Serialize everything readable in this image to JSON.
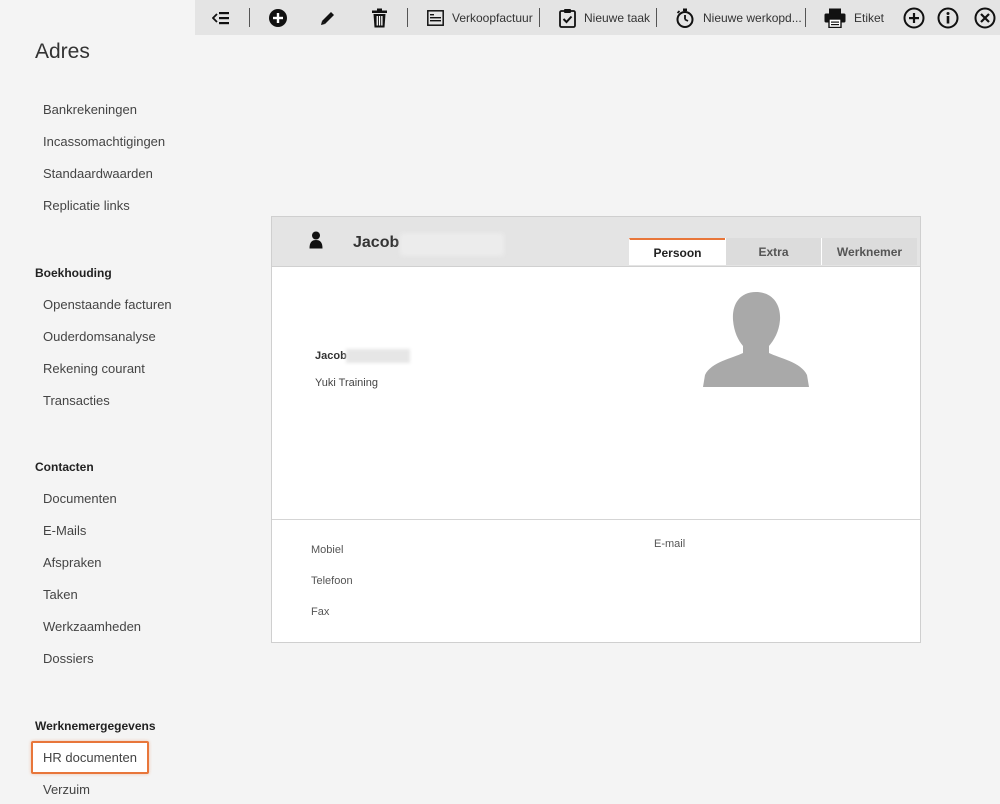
{
  "toolbar": {
    "verkoopfactuur": "Verkoopfactuur",
    "nieuwe_taak": "Nieuwe taak",
    "nieuwe_werkopdracht": "Nieuwe werkopd...",
    "etiket": "Etiket"
  },
  "page_title": "Adres",
  "sidebar": {
    "group1": [
      "Bankrekeningen",
      "Incassomachtigingen",
      "Standaardwaarden",
      "Replicatie links"
    ],
    "boekhouding": {
      "title": "Boekhouding",
      "items": [
        "Openstaande facturen",
        "Ouderdomsanalyse",
        "Rekening courant",
        "Transacties"
      ]
    },
    "contacten": {
      "title": "Contacten",
      "items": [
        "Documenten",
        "E-Mails",
        "Afspraken",
        "Taken",
        "Werkzaamheden",
        "Dossiers"
      ]
    },
    "werknemer": {
      "title": "Werknemergegevens",
      "items": [
        "HR documenten",
        "Verzuim"
      ]
    }
  },
  "card": {
    "name": "Jacob",
    "tabs": [
      "Persoon",
      "Extra",
      "Werknemer"
    ],
    "info_name": "Jacob",
    "company": "Yuki Training",
    "fields": {
      "mobiel": "Mobiel",
      "telefoon": "Telefoon",
      "fax": "Fax",
      "email": "E-mail"
    }
  },
  "colors": {
    "accent": "#e8763a",
    "toolbar_bg": "#e4e4e4",
    "page_bg": "#f4f4f4"
  }
}
